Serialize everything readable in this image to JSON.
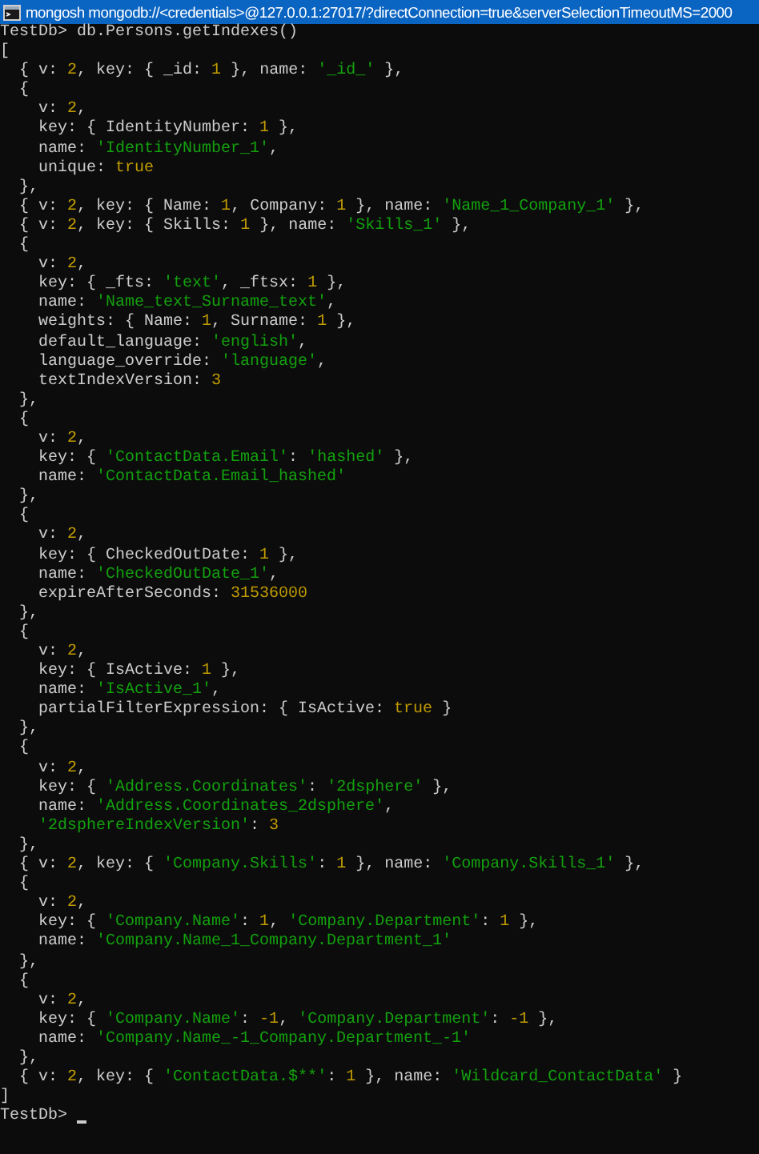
{
  "window": {
    "title": "mongosh mongodb://<credentials>@127.0.0.1:27017/?directConnection=true&serverSelectionTimeoutMS=2000"
  },
  "lines": [
    [
      {
        "kind": "plain",
        "text": "TestDb> db.Persons.getIndexes()"
      }
    ],
    [
      {
        "kind": "plain",
        "text": "["
      }
    ],
    [
      {
        "kind": "plain",
        "text": "  { v: "
      },
      {
        "kind": "number",
        "text": "2"
      },
      {
        "kind": "plain",
        "text": ", key: { _id: "
      },
      {
        "kind": "number",
        "text": "1"
      },
      {
        "kind": "plain",
        "text": " }, name: "
      },
      {
        "kind": "string",
        "text": "'_id_'"
      },
      {
        "kind": "plain",
        "text": " },"
      }
    ],
    [
      {
        "kind": "plain",
        "text": "  {"
      }
    ],
    [
      {
        "kind": "plain",
        "text": "    v: "
      },
      {
        "kind": "number",
        "text": "2"
      },
      {
        "kind": "plain",
        "text": ","
      }
    ],
    [
      {
        "kind": "plain",
        "text": "    key: { IdentityNumber: "
      },
      {
        "kind": "number",
        "text": "1"
      },
      {
        "kind": "plain",
        "text": " },"
      }
    ],
    [
      {
        "kind": "plain",
        "text": "    name: "
      },
      {
        "kind": "string",
        "text": "'IdentityNumber_1'"
      },
      {
        "kind": "plain",
        "text": ","
      }
    ],
    [
      {
        "kind": "plain",
        "text": "    unique: "
      },
      {
        "kind": "number",
        "text": "true"
      }
    ],
    [
      {
        "kind": "plain",
        "text": "  },"
      }
    ],
    [
      {
        "kind": "plain",
        "text": "  { v: "
      },
      {
        "kind": "number",
        "text": "2"
      },
      {
        "kind": "plain",
        "text": ", key: { Name: "
      },
      {
        "kind": "number",
        "text": "1"
      },
      {
        "kind": "plain",
        "text": ", Company: "
      },
      {
        "kind": "number",
        "text": "1"
      },
      {
        "kind": "plain",
        "text": " }, name: "
      },
      {
        "kind": "string",
        "text": "'Name_1_Company_1'"
      },
      {
        "kind": "plain",
        "text": " },"
      }
    ],
    [
      {
        "kind": "plain",
        "text": "  { v: "
      },
      {
        "kind": "number",
        "text": "2"
      },
      {
        "kind": "plain",
        "text": ", key: { Skills: "
      },
      {
        "kind": "number",
        "text": "1"
      },
      {
        "kind": "plain",
        "text": " }, name: "
      },
      {
        "kind": "string",
        "text": "'Skills_1'"
      },
      {
        "kind": "plain",
        "text": " },"
      }
    ],
    [
      {
        "kind": "plain",
        "text": "  {"
      }
    ],
    [
      {
        "kind": "plain",
        "text": "    v: "
      },
      {
        "kind": "number",
        "text": "2"
      },
      {
        "kind": "plain",
        "text": ","
      }
    ],
    [
      {
        "kind": "plain",
        "text": "    key: { _fts: "
      },
      {
        "kind": "string",
        "text": "'text'"
      },
      {
        "kind": "plain",
        "text": ", _ftsx: "
      },
      {
        "kind": "number",
        "text": "1"
      },
      {
        "kind": "plain",
        "text": " },"
      }
    ],
    [
      {
        "kind": "plain",
        "text": "    name: "
      },
      {
        "kind": "string",
        "text": "'Name_text_Surname_text'"
      },
      {
        "kind": "plain",
        "text": ","
      }
    ],
    [
      {
        "kind": "plain",
        "text": "    weights: { Name: "
      },
      {
        "kind": "number",
        "text": "1"
      },
      {
        "kind": "plain",
        "text": ", Surname: "
      },
      {
        "kind": "number",
        "text": "1"
      },
      {
        "kind": "plain",
        "text": " },"
      }
    ],
    [
      {
        "kind": "plain",
        "text": "    default_language: "
      },
      {
        "kind": "string",
        "text": "'english'"
      },
      {
        "kind": "plain",
        "text": ","
      }
    ],
    [
      {
        "kind": "plain",
        "text": "    language_override: "
      },
      {
        "kind": "string",
        "text": "'language'"
      },
      {
        "kind": "plain",
        "text": ","
      }
    ],
    [
      {
        "kind": "plain",
        "text": "    textIndexVersion: "
      },
      {
        "kind": "number",
        "text": "3"
      }
    ],
    [
      {
        "kind": "plain",
        "text": "  },"
      }
    ],
    [
      {
        "kind": "plain",
        "text": "  {"
      }
    ],
    [
      {
        "kind": "plain",
        "text": "    v: "
      },
      {
        "kind": "number",
        "text": "2"
      },
      {
        "kind": "plain",
        "text": ","
      }
    ],
    [
      {
        "kind": "plain",
        "text": "    key: { "
      },
      {
        "kind": "string",
        "text": "'ContactData.Email'"
      },
      {
        "kind": "plain",
        "text": ": "
      },
      {
        "kind": "string",
        "text": "'hashed'"
      },
      {
        "kind": "plain",
        "text": " },"
      }
    ],
    [
      {
        "kind": "plain",
        "text": "    name: "
      },
      {
        "kind": "string",
        "text": "'ContactData.Email_hashed'"
      }
    ],
    [
      {
        "kind": "plain",
        "text": "  },"
      }
    ],
    [
      {
        "kind": "plain",
        "text": "  {"
      }
    ],
    [
      {
        "kind": "plain",
        "text": "    v: "
      },
      {
        "kind": "number",
        "text": "2"
      },
      {
        "kind": "plain",
        "text": ","
      }
    ],
    [
      {
        "kind": "plain",
        "text": "    key: { CheckedOutDate: "
      },
      {
        "kind": "number",
        "text": "1"
      },
      {
        "kind": "plain",
        "text": " },"
      }
    ],
    [
      {
        "kind": "plain",
        "text": "    name: "
      },
      {
        "kind": "string",
        "text": "'CheckedOutDate_1'"
      },
      {
        "kind": "plain",
        "text": ","
      }
    ],
    [
      {
        "kind": "plain",
        "text": "    expireAfterSeconds: "
      },
      {
        "kind": "number",
        "text": "31536000"
      }
    ],
    [
      {
        "kind": "plain",
        "text": "  },"
      }
    ],
    [
      {
        "kind": "plain",
        "text": "  {"
      }
    ],
    [
      {
        "kind": "plain",
        "text": "    v: "
      },
      {
        "kind": "number",
        "text": "2"
      },
      {
        "kind": "plain",
        "text": ","
      }
    ],
    [
      {
        "kind": "plain",
        "text": "    key: { IsActive: "
      },
      {
        "kind": "number",
        "text": "1"
      },
      {
        "kind": "plain",
        "text": " },"
      }
    ],
    [
      {
        "kind": "plain",
        "text": "    name: "
      },
      {
        "kind": "string",
        "text": "'IsActive_1'"
      },
      {
        "kind": "plain",
        "text": ","
      }
    ],
    [
      {
        "kind": "plain",
        "text": "    partialFilterExpression: { IsActive: "
      },
      {
        "kind": "number",
        "text": "true"
      },
      {
        "kind": "plain",
        "text": " }"
      }
    ],
    [
      {
        "kind": "plain",
        "text": "  },"
      }
    ],
    [
      {
        "kind": "plain",
        "text": "  {"
      }
    ],
    [
      {
        "kind": "plain",
        "text": "    v: "
      },
      {
        "kind": "number",
        "text": "2"
      },
      {
        "kind": "plain",
        "text": ","
      }
    ],
    [
      {
        "kind": "plain",
        "text": "    key: { "
      },
      {
        "kind": "string",
        "text": "'Address.Coordinates'"
      },
      {
        "kind": "plain",
        "text": ": "
      },
      {
        "kind": "string",
        "text": "'2dsphere'"
      },
      {
        "kind": "plain",
        "text": " },"
      }
    ],
    [
      {
        "kind": "plain",
        "text": "    name: "
      },
      {
        "kind": "string",
        "text": "'Address.Coordinates_2dsphere'"
      },
      {
        "kind": "plain",
        "text": ","
      }
    ],
    [
      {
        "kind": "string",
        "text": "    '2dsphereIndexVersion'"
      },
      {
        "kind": "plain",
        "text": ": "
      },
      {
        "kind": "number",
        "text": "3"
      }
    ],
    [
      {
        "kind": "plain",
        "text": "  },"
      }
    ],
    [
      {
        "kind": "plain",
        "text": "  { v: "
      },
      {
        "kind": "number",
        "text": "2"
      },
      {
        "kind": "plain",
        "text": ", key: { "
      },
      {
        "kind": "string",
        "text": "'Company.Skills'"
      },
      {
        "kind": "plain",
        "text": ": "
      },
      {
        "kind": "number",
        "text": "1"
      },
      {
        "kind": "plain",
        "text": " }, name: "
      },
      {
        "kind": "string",
        "text": "'Company.Skills_1'"
      },
      {
        "kind": "plain",
        "text": " },"
      }
    ],
    [
      {
        "kind": "plain",
        "text": "  {"
      }
    ],
    [
      {
        "kind": "plain",
        "text": "    v: "
      },
      {
        "kind": "number",
        "text": "2"
      },
      {
        "kind": "plain",
        "text": ","
      }
    ],
    [
      {
        "kind": "plain",
        "text": "    key: { "
      },
      {
        "kind": "string",
        "text": "'Company.Name'"
      },
      {
        "kind": "plain",
        "text": ": "
      },
      {
        "kind": "number",
        "text": "1"
      },
      {
        "kind": "plain",
        "text": ", "
      },
      {
        "kind": "string",
        "text": "'Company.Department'"
      },
      {
        "kind": "plain",
        "text": ": "
      },
      {
        "kind": "number",
        "text": "1"
      },
      {
        "kind": "plain",
        "text": " },"
      }
    ],
    [
      {
        "kind": "plain",
        "text": "    name: "
      },
      {
        "kind": "string",
        "text": "'Company.Name_1_Company.Department_1'"
      }
    ],
    [
      {
        "kind": "plain",
        "text": "  },"
      }
    ],
    [
      {
        "kind": "plain",
        "text": "  {"
      }
    ],
    [
      {
        "kind": "plain",
        "text": "    v: "
      },
      {
        "kind": "number",
        "text": "2"
      },
      {
        "kind": "plain",
        "text": ","
      }
    ],
    [
      {
        "kind": "plain",
        "text": "    key: { "
      },
      {
        "kind": "string",
        "text": "'Company.Name'"
      },
      {
        "kind": "plain",
        "text": ": "
      },
      {
        "kind": "number",
        "text": "-1"
      },
      {
        "kind": "plain",
        "text": ", "
      },
      {
        "kind": "string",
        "text": "'Company.Department'"
      },
      {
        "kind": "plain",
        "text": ": "
      },
      {
        "kind": "number",
        "text": "-1"
      },
      {
        "kind": "plain",
        "text": " },"
      }
    ],
    [
      {
        "kind": "plain",
        "text": "    name: "
      },
      {
        "kind": "string",
        "text": "'Company.Name_-1_Company.Department_-1'"
      }
    ],
    [
      {
        "kind": "plain",
        "text": "  },"
      }
    ],
    [
      {
        "kind": "plain",
        "text": "  { v: "
      },
      {
        "kind": "number",
        "text": "2"
      },
      {
        "kind": "plain",
        "text": ", key: { "
      },
      {
        "kind": "string",
        "text": "'ContactData.$**'"
      },
      {
        "kind": "plain",
        "text": ": "
      },
      {
        "kind": "number",
        "text": "1"
      },
      {
        "kind": "plain",
        "text": " }, name: "
      },
      {
        "kind": "string",
        "text": "'Wildcard_ContactData'"
      },
      {
        "kind": "plain",
        "text": " }"
      }
    ],
    [
      {
        "kind": "plain",
        "text": "]"
      }
    ]
  ],
  "prompt": {
    "text": "TestDb> ",
    "cursor": true
  }
}
